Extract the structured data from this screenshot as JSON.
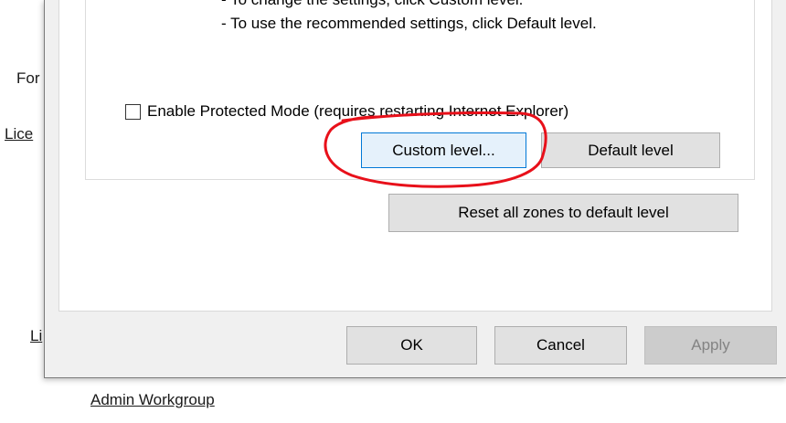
{
  "background": {
    "text_for": "For",
    "link_lice": "Lice",
    "link_li": "Li",
    "link_admin": "Admin Workgroup"
  },
  "security_level_description": {
    "cut_off_line": "- To change the settings, click Custom level.",
    "default_hint": "- To use the recommended settings, click Default level."
  },
  "protected_mode": {
    "label": "Enable Protected Mode (requires restarting Internet Explorer)",
    "checked": false
  },
  "buttons": {
    "custom_level": "Custom level...",
    "default_level": "Default level",
    "reset_all": "Reset all zones to default level"
  },
  "footer": {
    "ok": "OK",
    "cancel": "Cancel",
    "apply": "Apply"
  },
  "colors": {
    "annotation_red": "#e8101a",
    "focus_blue": "#0078d7",
    "dialog_bg": "#f0f0f0"
  }
}
